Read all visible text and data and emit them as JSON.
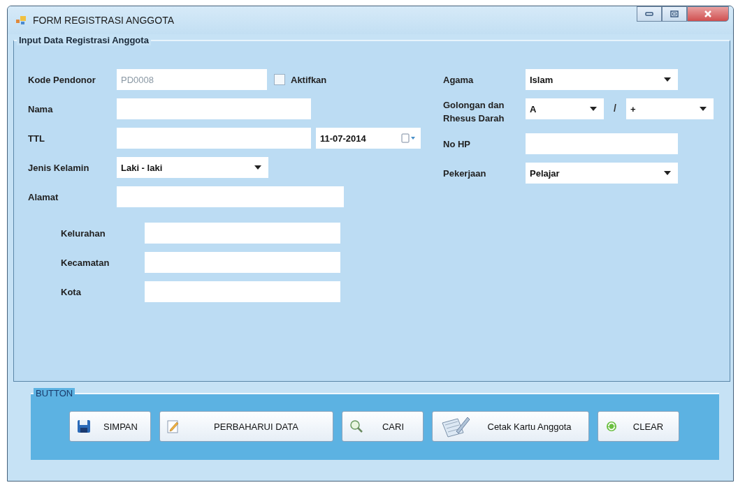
{
  "window": {
    "title": "FORM REGISTRASI ANGGOTA"
  },
  "group": {
    "title": "Input Data Registrasi Anggota"
  },
  "kode_pendonor": {
    "label": "Kode Pendonor",
    "value": "PD0008",
    "readonly": true
  },
  "aktifkan": {
    "label": "Aktifkan",
    "checked": false
  },
  "nama": {
    "label": "Nama"
  },
  "ttl": {
    "label": "TTL",
    "date": "11-07-2014"
  },
  "jenis_kelamin": {
    "label": "Jenis Kelamin",
    "value": "Laki - laki"
  },
  "alamat": {
    "label": "Alamat"
  },
  "alamat_parts": [
    {
      "label": "Kelurahan"
    },
    {
      "label": "Kecamatan"
    },
    {
      "label": "Kota"
    }
  ],
  "agama": {
    "label": "Agama",
    "value": "Islam"
  },
  "golongan": {
    "label": "Golongan dan Rhesus Darah",
    "blood_type": "A",
    "separator": "/",
    "rhesus": "+"
  },
  "no_hp": {
    "label": "No HP"
  },
  "pekerjaan": {
    "label": "Pekerjaan",
    "value": "Pelajar"
  },
  "button_group": {
    "title": "BUTTON",
    "buttons": [
      {
        "label": "SIMPAN",
        "kind": "save"
      },
      {
        "label": "PERBAHARUI DATA",
        "kind": "edit"
      },
      {
        "label": "CARI",
        "kind": "search"
      },
      {
        "label": "Cetak Kartu Anggota",
        "kind": "print"
      },
      {
        "label": "CLEAR",
        "kind": "refresh"
      }
    ]
  }
}
